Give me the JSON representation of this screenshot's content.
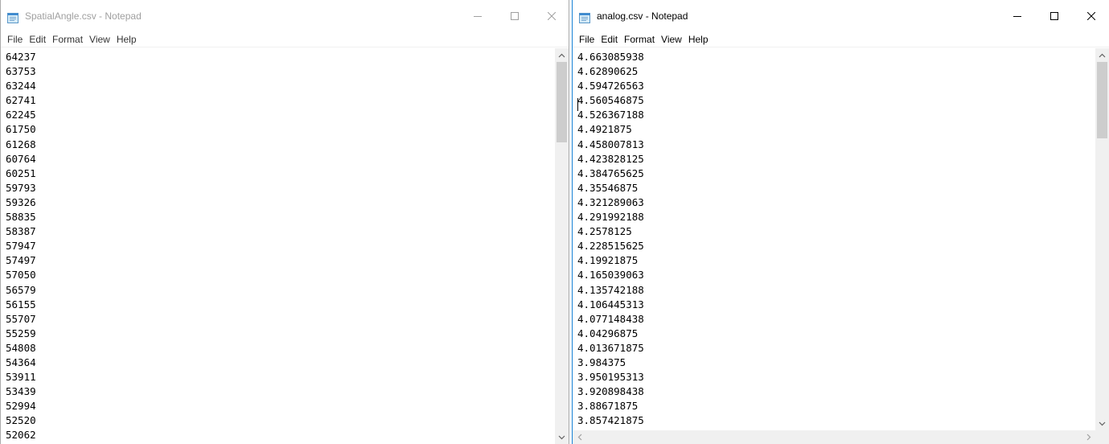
{
  "windows": [
    {
      "title": "SpatialAngle.csv - Notepad",
      "focused": false,
      "menu": [
        "File",
        "Edit",
        "Format",
        "View",
        "Help"
      ],
      "lines": [
        "64237",
        "63753",
        "63244",
        "62741",
        "62245",
        "61750",
        "61268",
        "60764",
        "60251",
        "59793",
        "59326",
        "58835",
        "58387",
        "57947",
        "57497",
        "57050",
        "56579",
        "56155",
        "55707",
        "55259",
        "54808",
        "54364",
        "53911",
        "53439",
        "52994",
        "52520",
        "52062"
      ]
    },
    {
      "title": "analog.csv - Notepad",
      "focused": true,
      "menu": [
        "File",
        "Edit",
        "Format",
        "View",
        "Help"
      ],
      "lines": [
        "4.663085938",
        "4.62890625",
        "4.594726563",
        "4.560546875",
        "4.526367188",
        "4.4921875",
        "4.458007813",
        "4.423828125",
        "4.384765625",
        "4.35546875",
        "4.321289063",
        "4.291992188",
        "4.2578125",
        "4.228515625",
        "4.19921875",
        "4.165039063",
        "4.135742188",
        "4.106445313",
        "4.077148438",
        "4.04296875",
        "4.013671875",
        "3.984375",
        "3.950195313",
        "3.920898438",
        "3.88671875",
        "3.857421875"
      ]
    }
  ],
  "colors": {
    "focused_border": "#1883d7",
    "inactive_title": "#a0a0a0",
    "scroll_track": "#f0f0f0",
    "scroll_thumb": "#cdcdcd"
  },
  "icons": {
    "app": "notepad-icon",
    "minimize": "minimize-icon",
    "maximize": "maximize-icon",
    "close": "close-icon"
  }
}
